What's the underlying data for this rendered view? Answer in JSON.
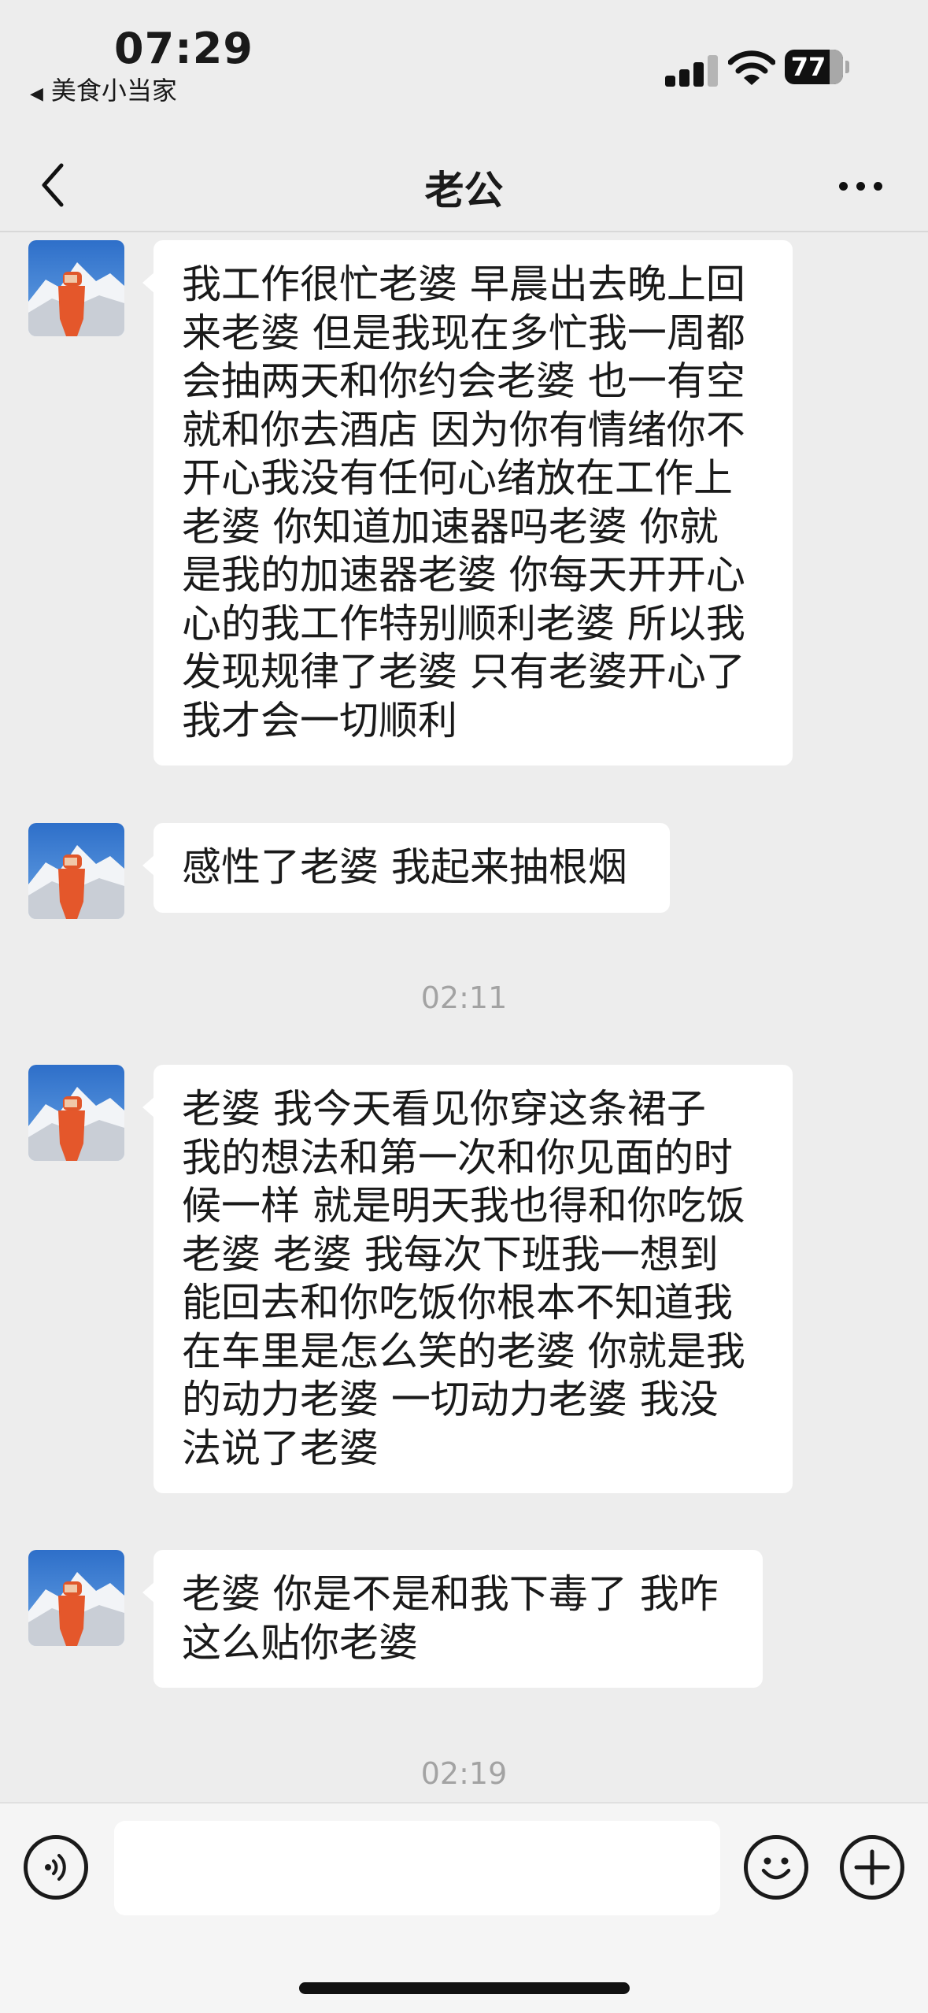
{
  "status_bar": {
    "time": "07:29",
    "back_app": "美食小当家",
    "battery": "77"
  },
  "nav": {
    "title": "老公",
    "back_icon": "chevron-left-icon",
    "more_icon": "more-dots-icon"
  },
  "messages": [
    {
      "sender": "other",
      "lines": [
        "我工作很忙老婆 早晨出去晚上回",
        "来老婆 但是我现在多忙我一周都",
        "会抽两天和你约会老婆 也一有空",
        "就和你去酒店 因为你有情绪你不",
        "开心我没有任何心绪放在工作上",
        "老婆 你知道加速器吗老婆 你就",
        "是我的加速器老婆 你每天开开心",
        "心的我工作特别顺利老婆 所以我",
        "发现规律了老婆 只有老婆开心了",
        "我才会一切顺利"
      ]
    },
    {
      "sender": "other",
      "lines": [
        "感性了老婆 我起来抽根烟"
      ]
    },
    {
      "sender": "other",
      "lines": [
        "老婆  我今天看见你穿这条裙子",
        "我的想法和第一次和你见面的时",
        "候一样 就是明天我也得和你吃饭",
        "老婆 老婆 我每次下班我一想到",
        "能回去和你吃饭你根本不知道我",
        "在车里是怎么笑的老婆 你就是我",
        "的动力老婆 一切动力老婆 我没",
        "法说了老婆"
      ]
    },
    {
      "sender": "other",
      "lines": [
        "老婆 你是不是和我下毒了 我咋",
        "这么贴你老婆"
      ]
    }
  ],
  "timestamps": [
    "02:11",
    "02:19"
  ],
  "input_bar": {
    "voice_icon": "voice-icon",
    "input_value": "",
    "emoji_icon": "emoji-icon",
    "plus_icon": "plus-icon"
  }
}
